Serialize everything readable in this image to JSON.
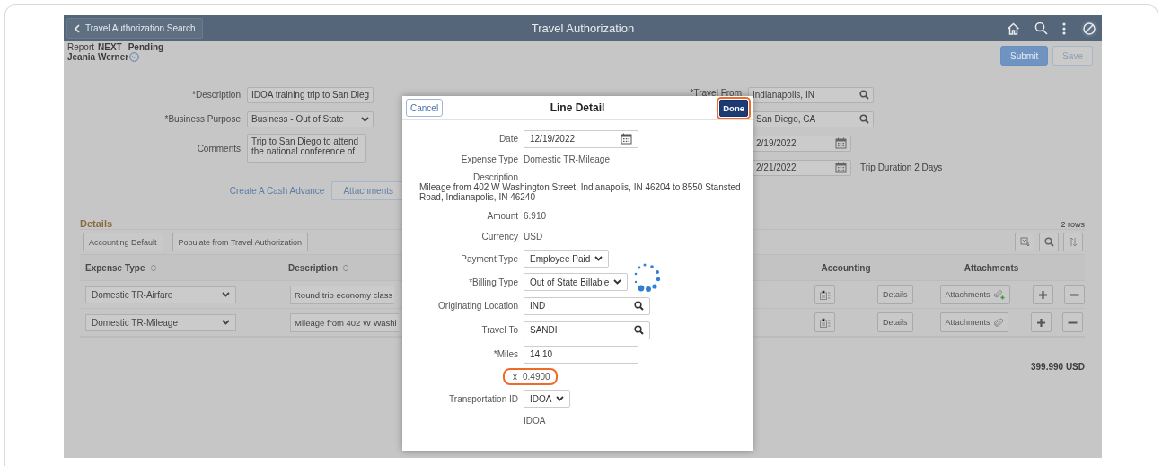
{
  "header": {
    "back_button": "Travel Authorization Search",
    "title": "Travel Authorization"
  },
  "report": {
    "label": "Report",
    "id": "NEXT",
    "status": "Pending",
    "user": "Jeania Werner"
  },
  "actions": [
    {
      "label": "Submit",
      "kind": "primary"
    },
    {
      "label": "Save",
      "kind": "secondary"
    }
  ],
  "form_left": [
    {
      "label": "*Description",
      "kind": "text",
      "value": "IDOA training trip to San Dieg"
    },
    {
      "label": "*Business Purpose",
      "kind": "select",
      "value": "Business - Out of State"
    },
    {
      "label": "Comments",
      "kind": "textarea",
      "value": "Trip to San Diego to attend the national conference of"
    }
  ],
  "links": {
    "cash_advance": "Create A Cash Advance",
    "attachments": "Attachments"
  },
  "form_right": [
    {
      "label": "*Travel From",
      "kind": "lookup",
      "value": "Indianapolis, IN"
    },
    {
      "kind": "lookup",
      "value": "San Diego, CA"
    },
    {
      "kind": "date",
      "value": "2/19/2022"
    },
    {
      "kind": "date",
      "value": "2/21/2022",
      "note": "Trip Duration 2 Days"
    }
  ],
  "details": {
    "title": "Details",
    "row_count": "2 rows",
    "buttons": [
      "Accounting Default",
      "Populate from Travel Authorization"
    ],
    "columns": [
      "Expense Type",
      "Description",
      "Accounting",
      "Attachments"
    ],
    "rows": [
      {
        "expense_type": "Domestic TR-Airfare",
        "description": "Round trip economy class",
        "details": "Details",
        "attachments": "Attachments",
        "has_attachment": false
      },
      {
        "expense_type": "Domestic TR-Mileage",
        "description": "Mileage from 402 W Washi",
        "details": "Details",
        "attachments": "Attachments",
        "has_attachment": true
      }
    ],
    "total": "399.990 USD"
  },
  "line_detail": {
    "title": "Line Detail",
    "cancel": "Cancel",
    "done": {
      "label": "Done",
      "highlighted": true
    },
    "loading": true,
    "fields": [
      {
        "label": "Date",
        "kind": "date",
        "value": "12/19/2022"
      },
      {
        "label": "Expense Type",
        "kind": "text",
        "value": "Domestic TR-Mileage"
      },
      {
        "label": "Description",
        "kind": "block",
        "value": "Mileage from 402 W Washington Street, Indianapolis, IN 46204 to 8550 Stansted Road, Indianapolis, IN 46240"
      },
      {
        "label": "Amount",
        "kind": "text",
        "value": "6.910"
      },
      {
        "label": "Currency",
        "kind": "text",
        "value": "USD"
      },
      {
        "label": "Payment Type",
        "kind": "select",
        "value": "Employee Paid"
      },
      {
        "label": "*Billing Type",
        "kind": "select",
        "value": "Out of State Billable"
      },
      {
        "label": "Originating Location",
        "kind": "lookup",
        "value": "IND"
      },
      {
        "label": "Travel To",
        "kind": "lookup",
        "value": "SANDI"
      },
      {
        "label": "*Miles",
        "kind": "input",
        "value": "14.10"
      },
      {
        "label": "x",
        "kind": "text",
        "value": "0.4900",
        "highlighted": true
      },
      {
        "label": "Transportation ID",
        "kind": "select",
        "value": "IDOA"
      },
      {
        "kind": "text",
        "value": "IDOA"
      }
    ]
  }
}
